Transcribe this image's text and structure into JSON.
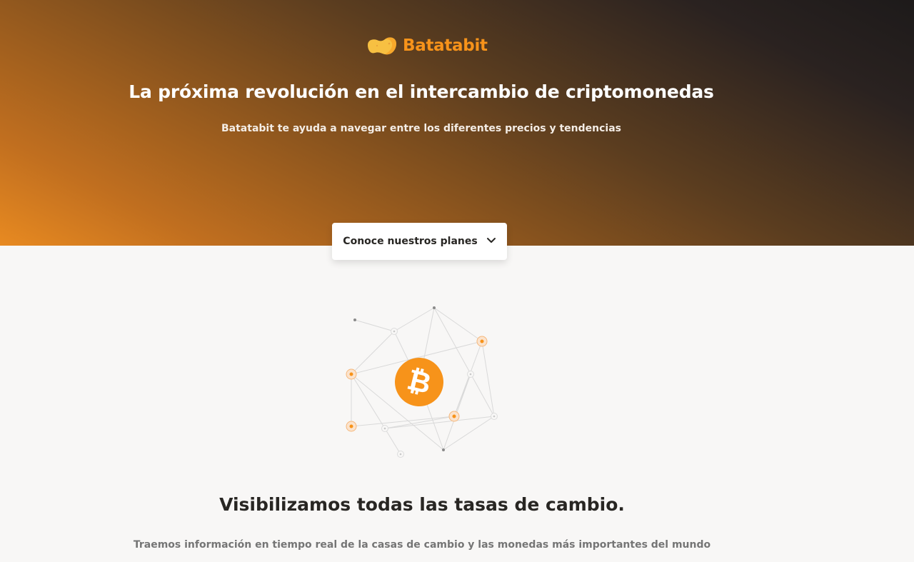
{
  "brand": {
    "name": "Batatabit",
    "icon": "potato-icon",
    "accent": "#f7931a"
  },
  "hero": {
    "title": "La próxima revolución en el intercambio de criptomonedas",
    "subtitle": "Batatabit te ayuda a navegar entre los diferentes precios y tendencias",
    "plans_button": {
      "label": "Conoce nuestros planes",
      "icon": "chevron-down-icon"
    }
  },
  "illustration": {
    "icon": "bitcoin-icon",
    "symbol": "₿"
  },
  "main": {
    "title": "Visibilizamos todas las tasas de cambio.",
    "subtitle": "Traemos información en tiempo real de la casas de cambio y las monedas más importantes del mundo"
  }
}
